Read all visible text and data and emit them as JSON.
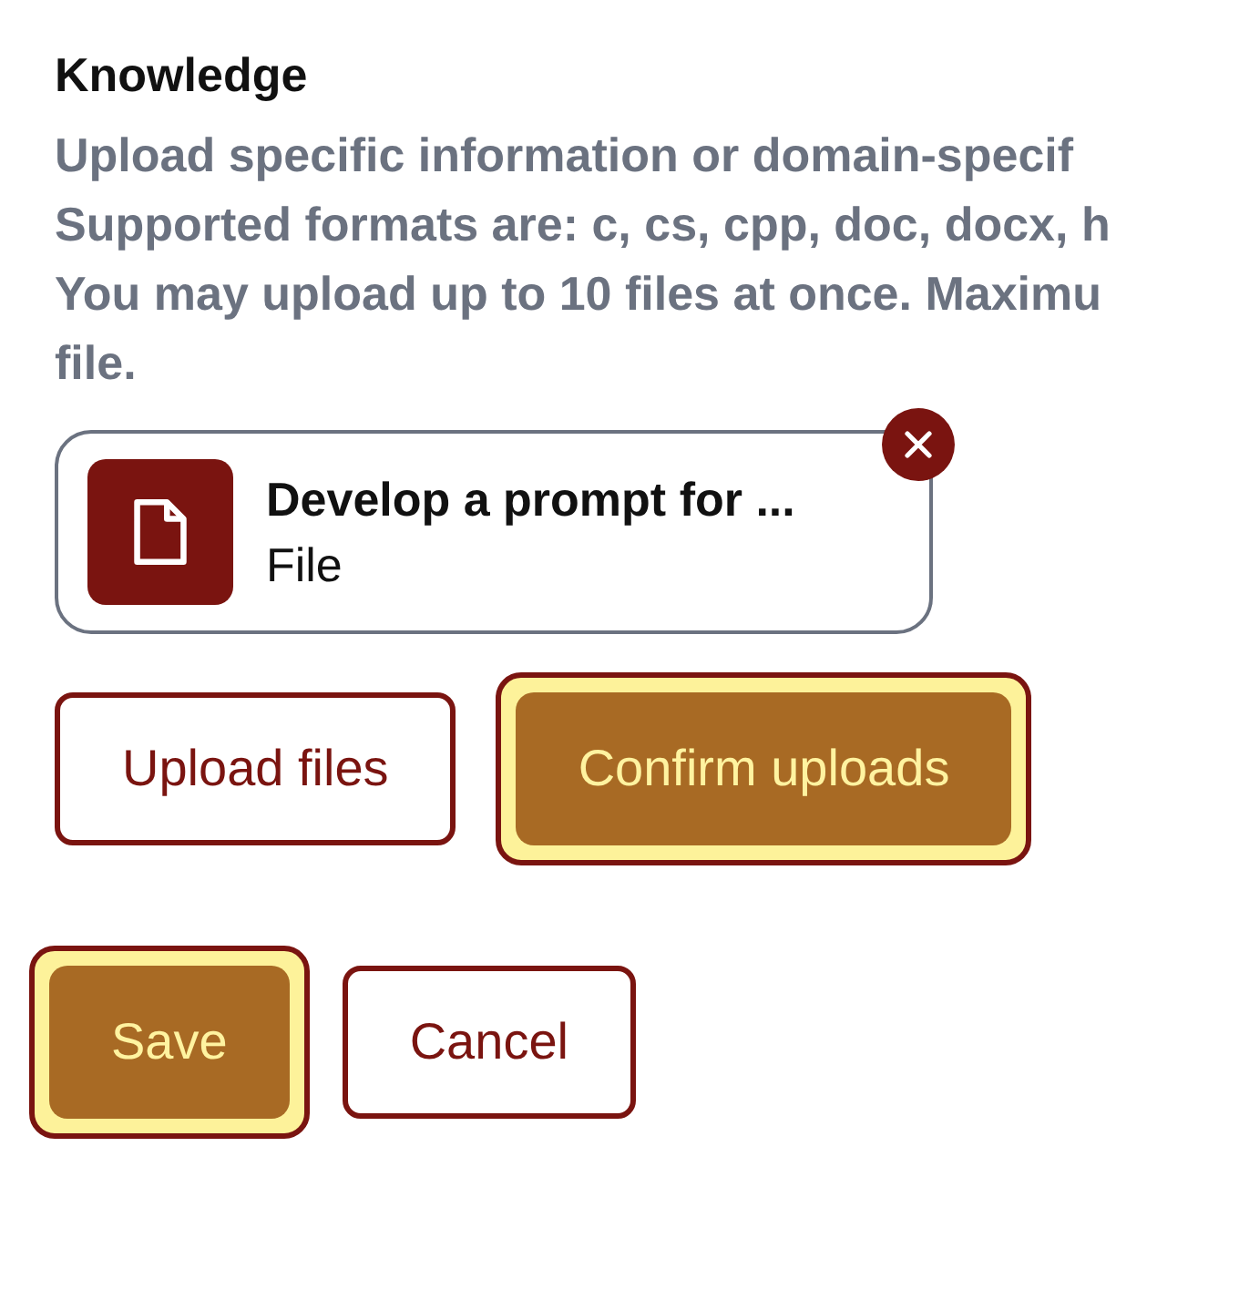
{
  "section": {
    "title": "Knowledge",
    "description_lines": [
      "Upload specific information or domain-specif",
      "Supported formats are: c, cs, cpp, doc, docx, h",
      "You may upload up to 10 files at once. Maximu",
      "file."
    ]
  },
  "files": [
    {
      "name": "Develop a prompt for ...",
      "type": "File"
    }
  ],
  "upload_buttons": [
    {
      "label": "Upload files",
      "kind": "outline",
      "focused": false
    },
    {
      "label": "Confirm uploads",
      "kind": "filled",
      "focused": true
    }
  ],
  "form_buttons": [
    {
      "label": "Save",
      "kind": "filled",
      "focused": true
    },
    {
      "label": "Cancel",
      "kind": "outline",
      "focused": false
    }
  ]
}
